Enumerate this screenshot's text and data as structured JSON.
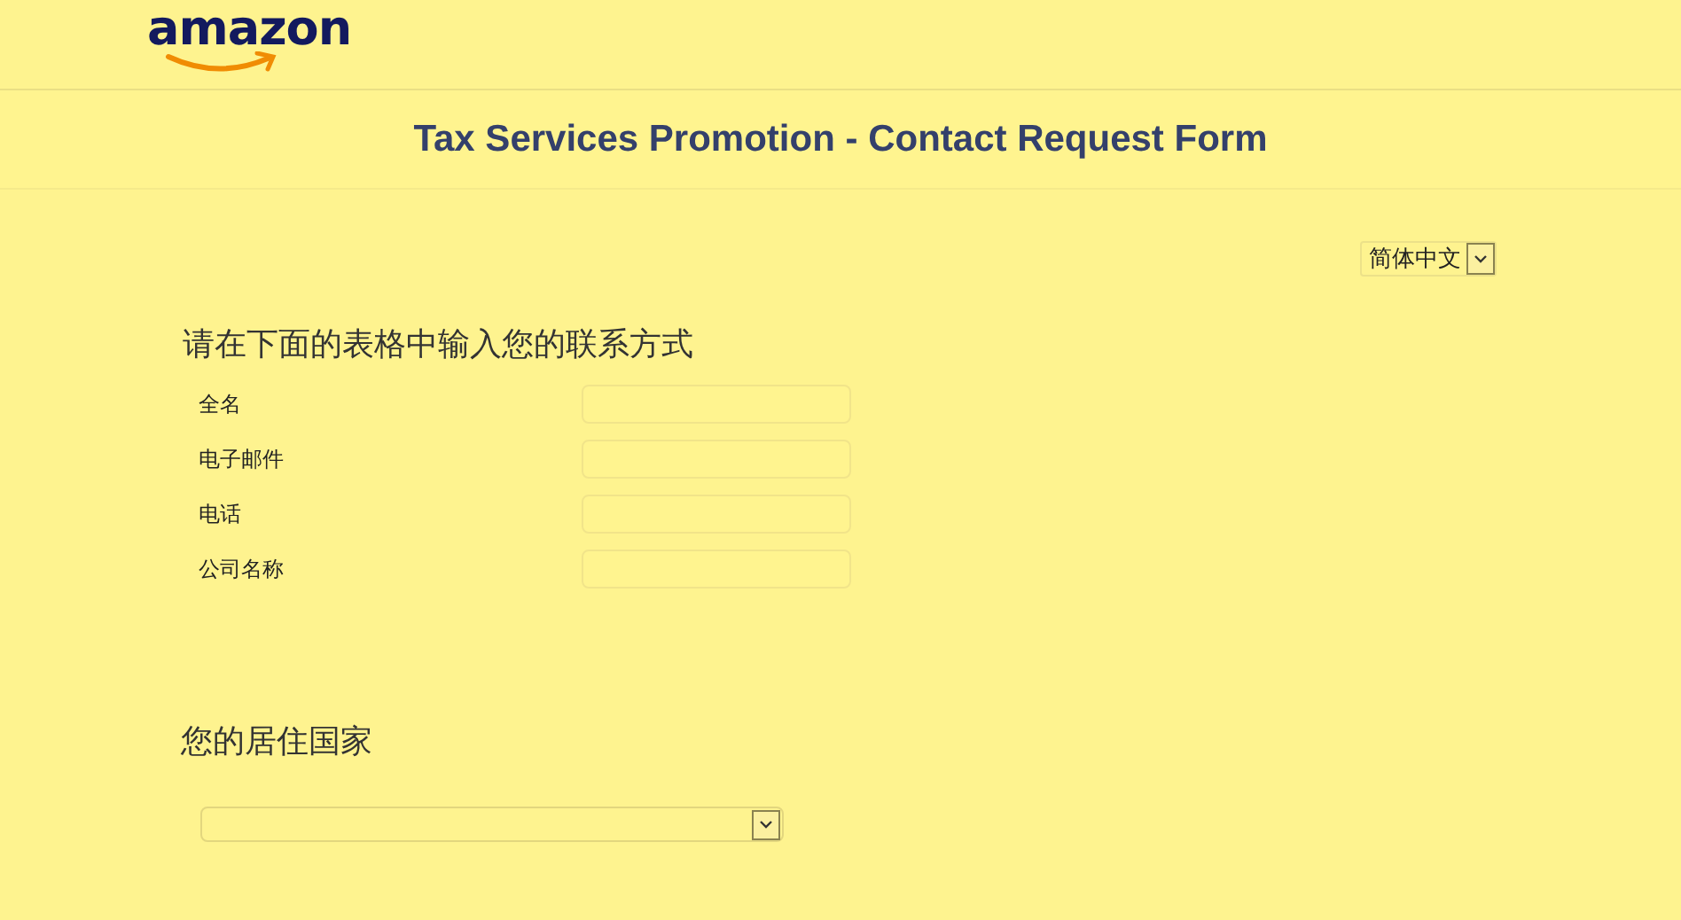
{
  "header": {
    "logo": "amazon"
  },
  "title": "Tax Services Promotion - Contact Request Form",
  "language_select": {
    "value": "简体中文"
  },
  "contact_section": {
    "heading": "请在下面的表格中输入您的联系方式",
    "fields": [
      {
        "label": "全名"
      },
      {
        "label": "电子邮件"
      },
      {
        "label": "电话"
      },
      {
        "label": "公司名称"
      }
    ]
  },
  "country_section": {
    "heading": "您的居住国家"
  }
}
